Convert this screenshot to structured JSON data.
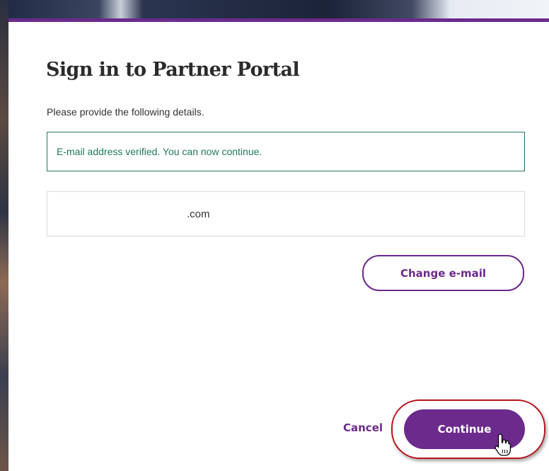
{
  "dialog": {
    "title": "Sign in to Partner Portal",
    "subtitle": "Please provide the following details.",
    "notice": "E-mail address verified. You can now continue.",
    "email_value": ".com",
    "change_email_label": "Change e-mail",
    "cancel_label": "Cancel",
    "continue_label": "Continue"
  },
  "colors": {
    "accent": "#6c2a8c",
    "success": "#1f7a5a",
    "highlight": "#b8141b"
  },
  "icons": {
    "cursor": "hand-pointer-icon"
  }
}
